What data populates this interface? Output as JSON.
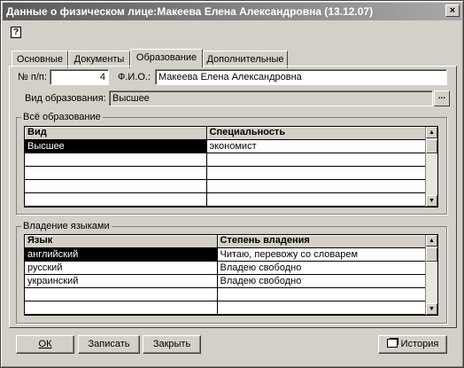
{
  "window": {
    "title": "Данные о физическом лице:Макеева Елена Александровна (13.12.07)",
    "close_glyph": "×",
    "help_glyph": "?"
  },
  "tabs": [
    {
      "label": "Основные"
    },
    {
      "label": "Документы"
    },
    {
      "label": "Образование",
      "active": true
    },
    {
      "label": "Дополнительные"
    }
  ],
  "form": {
    "num_label": "№ п/п:",
    "num_value": "4",
    "fio_label": "Ф.И.О.:",
    "fio_value": "Макеева Елена Александровна",
    "edu_type_label": "Вид образования:",
    "edu_type_value": "Высшее",
    "edu_type_button": "..."
  },
  "education": {
    "group_title": "Всё образование",
    "columns": [
      "Вид",
      "Специальность"
    ],
    "rows": [
      {
        "kind": "Высшее",
        "specialty": "экономист",
        "selected": true
      }
    ],
    "empty_rows": 5
  },
  "languages": {
    "group_title": "Владение языками",
    "columns": [
      "Язык",
      "Степень владения"
    ],
    "rows": [
      {
        "language": "английский",
        "level": "Читаю, перевожу со словарем",
        "selected": true
      },
      {
        "language": "русский",
        "level": "Владею свободно"
      },
      {
        "language": "украинский",
        "level": "Владею свободно"
      }
    ],
    "empty_rows": 2
  },
  "buttons": {
    "ok": "ОК",
    "save": "Записать",
    "close": "Закрыть",
    "history": "История"
  },
  "scroll_glyphs": {
    "up": "▲",
    "down": "▼"
  },
  "icons": {
    "history": "history-icon",
    "help": "help-icon",
    "close": "close-icon"
  }
}
